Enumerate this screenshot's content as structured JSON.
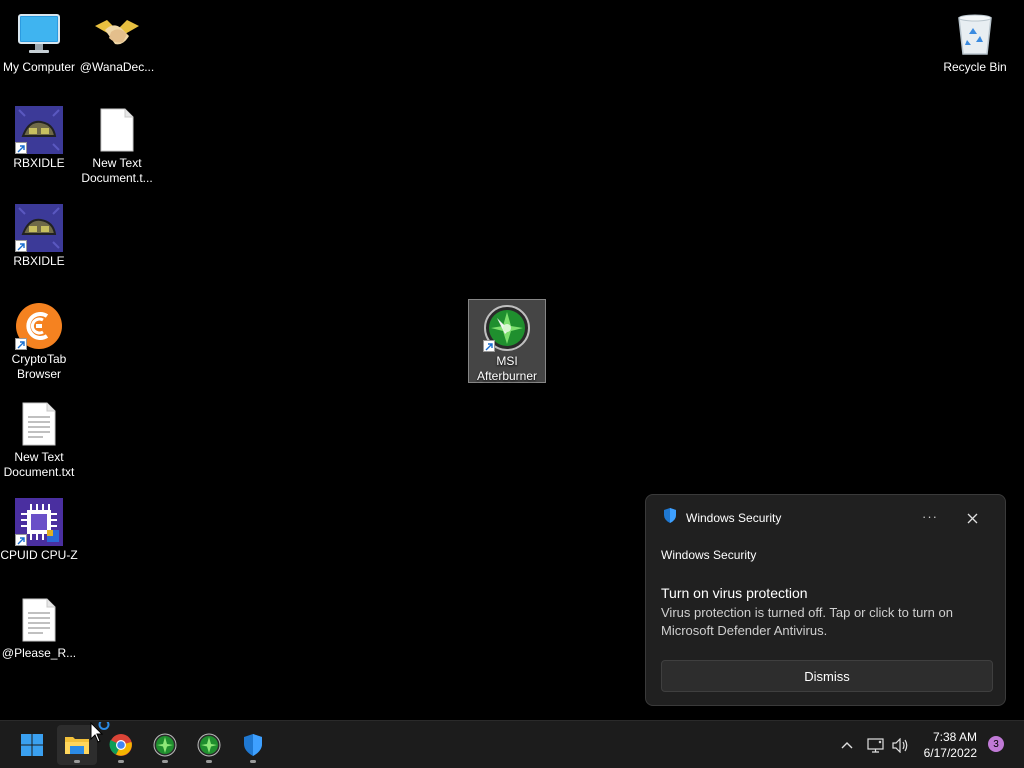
{
  "desktop": {
    "icons": {
      "my_computer": "My Computer",
      "wanadec": "@WanaDec...",
      "recycle_bin": "Recycle Bin",
      "rbxidle_1": "RBXIDLE",
      "new_text_doc_1": "New Text Document.t...",
      "rbxidle_2": "RBXIDLE",
      "cryptotab": "CryptoTab Browser",
      "new_text_doc_2": "New Text Document.txt",
      "cpuz": "CPUID CPU-Z",
      "please_r": "@Please_R...",
      "msi_afterburner": "MSI Afterburner"
    }
  },
  "toast": {
    "app_name": "Windows Security",
    "more_label": "···",
    "source": "Windows Security",
    "title": "Turn on virus protection",
    "message": "Virus protection is turned off. Tap or click to turn on Microsoft Defender Antivirus.",
    "dismiss_label": "Dismiss"
  },
  "taskbar": {
    "apps": [
      "start-icon",
      "file-explorer-icon",
      "chrome-icon",
      "msi-afterburner-icon",
      "msi-afterburner-icon",
      "windows-security-icon"
    ],
    "clock": {
      "time": "7:38 AM",
      "date": "6/17/2022"
    },
    "notification_count": "3"
  },
  "colors": {
    "desktop_bg": "#000000",
    "taskbar_bg": "#1c1c1c",
    "toast_bg": "#202020",
    "accent_blue": "#0a84ff",
    "badge": "#c07ad6"
  }
}
